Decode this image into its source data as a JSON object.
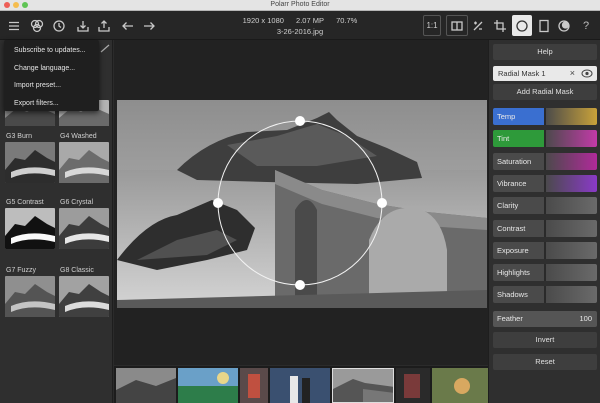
{
  "window": {
    "title": "Polarr Photo Editor"
  },
  "image_info": {
    "dimensions": "1920 x 1080",
    "megapixels": "2.07 MP",
    "zoom": "70.7%",
    "filename": "3-26-2016.jpg"
  },
  "toolbar": {
    "left_icons": [
      "menu-icon",
      "filters-icon",
      "history-icon",
      "import-icon",
      "export-icon",
      "undo-icon",
      "redo-icon"
    ],
    "zoom_fit": "1:1",
    "right_icons": [
      "compare-icon",
      "toggle-icon",
      "crop-icon",
      "local-adjust-icon",
      "panel-icon",
      "overlay-icon",
      "help-icon"
    ]
  },
  "menu": {
    "items": [
      "Subscribe to updates...",
      "Change language...",
      "Import preset...",
      "Export filters..."
    ]
  },
  "filters": [
    {
      "name": "G3 Burn"
    },
    {
      "name": "G4 Washed"
    },
    {
      "name": "G5 Contrast"
    },
    {
      "name": "G6 Crystal"
    },
    {
      "name": "G7 Fuzzy"
    },
    {
      "name": "G8 Classic"
    }
  ],
  "right_panel": {
    "help_label": "Help",
    "mask_name": "Radial Mask 1",
    "add_mask_label": "Add Radial Mask",
    "sliders": [
      {
        "label": "Temp",
        "left": "#3a6fd0",
        "right": "#c9a23a"
      },
      {
        "label": "Tint",
        "left": "#2e9a3a",
        "right": "#c23aa8"
      },
      {
        "label": "Saturation",
        "left": "#4a4a4a",
        "right": "#b02a9a"
      },
      {
        "label": "Vibrance",
        "left": "#4a4a4a",
        "right": "#8a3ac8"
      },
      {
        "label": "Clarity",
        "left": "#4a4a4a",
        "right": "#6a6a6a"
      },
      {
        "label": "Contrast",
        "left": "#4a4a4a",
        "right": "#6a6a6a"
      },
      {
        "label": "Exposure",
        "left": "#4a4a4a",
        "right": "#6a6a6a"
      },
      {
        "label": "Highlights",
        "left": "#4a4a4a",
        "right": "#6a6a6a"
      },
      {
        "label": "Shadows",
        "left": "#4a4a4a",
        "right": "#6a6a6a"
      }
    ],
    "feather_label": "Feather",
    "feather_value": "100",
    "invert_label": "Invert",
    "reset_label": "Reset"
  },
  "colors": {
    "accent_active": "#e8e8e8",
    "panel": "#2f2f2f",
    "canvas": "#222222"
  }
}
